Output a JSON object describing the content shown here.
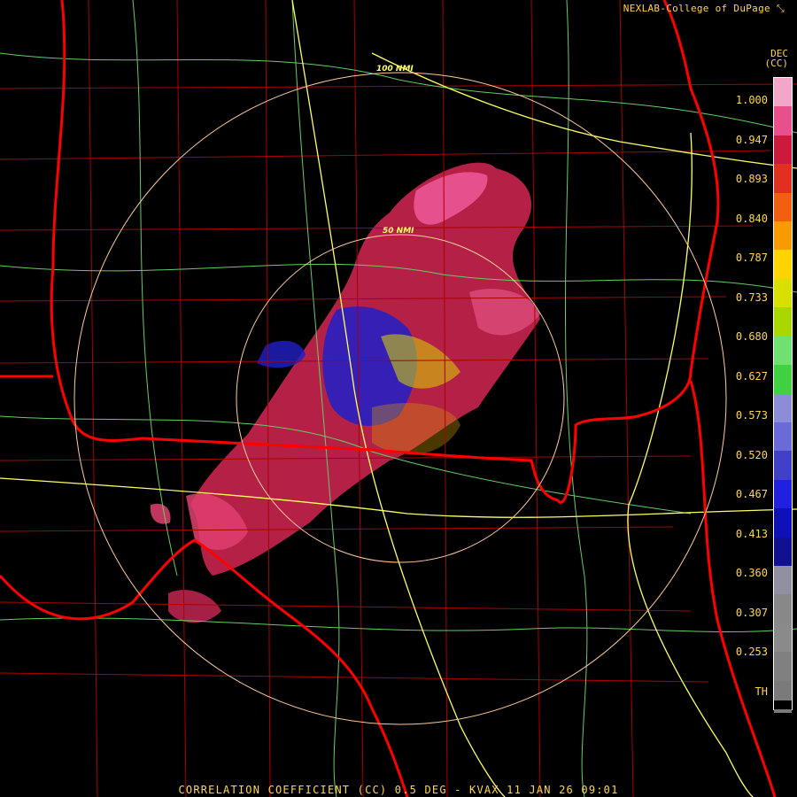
{
  "header": {
    "credit": "NEXLAB-College of DuPage"
  },
  "footer": {
    "product_line": "CORRELATION COEFFICIENT (CC) 0.5 DEG - KVAX 11 JAN 26 09:01"
  },
  "colorbar": {
    "units_top": "DEC",
    "units_bottom": "(CC)",
    "labels": [
      "1.000",
      "0.947",
      "0.893",
      "0.840",
      "0.787",
      "0.733",
      "0.680",
      "0.627",
      "0.573",
      "0.520",
      "0.467",
      "0.413",
      "0.360",
      "0.307",
      "0.253",
      "TH"
    ],
    "colors": [
      "#f4a6c8",
      "#e8508c",
      "#cc1a3c",
      "#e03020",
      "#f06010",
      "#f89a00",
      "#ffd400",
      "#d8e000",
      "#a8d800",
      "#70e070",
      "#40d040",
      "#8c8cd8",
      "#6a6ad8",
      "#4040c8",
      "#2020e0",
      "#1010b8",
      "#101090",
      "#9090a0",
      "#888888",
      "#8a8a8a",
      "#808080",
      "#7a7a7a"
    ]
  },
  "range_rings": {
    "ring_50": "50 NMI",
    "ring_100": "100 NMI"
  },
  "map_colors": {
    "state_borders": "#ff0000",
    "county_lines": "#aa0000",
    "highways": "#ffff66",
    "roads": "#66cc66",
    "ring": "#ffcc99"
  },
  "icons": {
    "credit_logo": "nexlab-logo-icon"
  }
}
